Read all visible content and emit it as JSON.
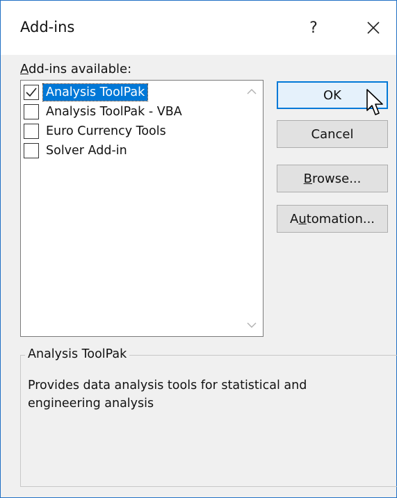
{
  "window": {
    "title": "Add-ins",
    "help_label": "?"
  },
  "addins": {
    "available_label_accel": "A",
    "available_label_rest": "dd-ins available:",
    "items": [
      {
        "label": "Analysis ToolPak",
        "checked": true,
        "selected": true
      },
      {
        "label": "Analysis ToolPak - VBA",
        "checked": false,
        "selected": false
      },
      {
        "label": "Euro Currency Tools",
        "checked": false,
        "selected": false
      },
      {
        "label": "Solver Add-in",
        "checked": false,
        "selected": false
      }
    ]
  },
  "buttons": {
    "ok": "OK",
    "cancel": "Cancel",
    "browse_accel": "B",
    "browse_rest": "rowse...",
    "automation_pre": "A",
    "automation_accel": "u",
    "automation_rest": "tomation..."
  },
  "description": {
    "title": "Analysis ToolPak",
    "text": "Provides data analysis tools for statistical and engineering analysis"
  },
  "colors": {
    "accent": "#0078d7",
    "window_border": "#1f6fc4",
    "dialog_bg": "#f0f0f0"
  }
}
